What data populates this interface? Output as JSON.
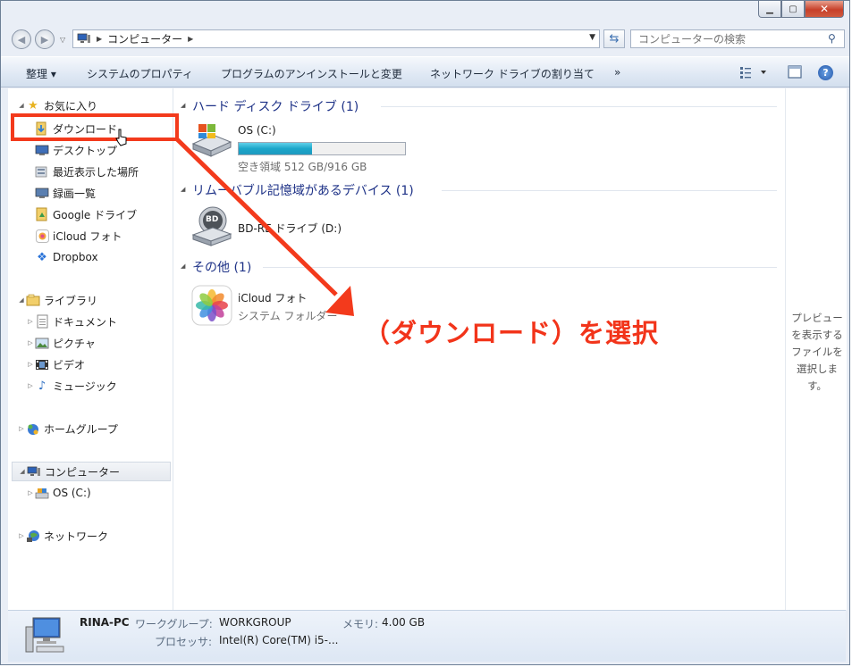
{
  "window": {
    "caption": {
      "minimize": "▁",
      "maximize": "▢",
      "close": "✕"
    }
  },
  "address": {
    "crumb": "コンピューター",
    "search_placeholder": "コンピューターの検索"
  },
  "toolbar": {
    "organize": "整理 ▾",
    "system_properties": "システムのプロパティ",
    "uninstall": "プログラムのアンインストールと変更",
    "map_drive": "ネットワーク ドライブの割り当て",
    "more": "»",
    "help": "?"
  },
  "nav": {
    "favorites": "お気に入り",
    "downloads": "ダウンロード",
    "desktop": "デスクトップ",
    "recent": "最近表示した場所",
    "recordings": "録画一覧",
    "google_drive": "Google ドライブ",
    "icloud_photos": "iCloud フォト",
    "dropbox": "Dropbox",
    "libraries": "ライブラリ",
    "documents": "ドキュメント",
    "pictures": "ピクチャ",
    "videos": "ビデオ",
    "music": "ミュージック",
    "homegroup": "ホームグループ",
    "computer": "コンピューター",
    "os_c": "OS (C:)",
    "network": "ネットワーク"
  },
  "content": {
    "group_hdd": "ハード ディスク ドライブ (1)",
    "os_drive_name": "OS (C:)",
    "os_drive_free": "空き領域 512 GB/916 GB",
    "os_drive_used_fraction": 0.44,
    "group_removable": "リムーバブル記憶域があるデバイス (1)",
    "bd_drive_name": "BD-RE ドライブ (D:)",
    "bd_label": "BD",
    "group_other": "その他 (1)",
    "icloud_name": "iCloud フォト",
    "icloud_sub": "システム フォルダー"
  },
  "preview": {
    "line1": "プレビュー",
    "line2": "を表示する",
    "line3": "ファイルを",
    "line4": "選択しま",
    "line5": "す。"
  },
  "details": {
    "pc_name": "RINA-PC",
    "workgroup_label": "ワークグループ:",
    "workgroup_value": "WORKGROUP",
    "memory_label": "メモリ:",
    "memory_value": "4.00 GB",
    "processor_label": "プロセッサ:",
    "processor_value": "Intel(R) Core(TM) i5-..."
  },
  "annotation": {
    "text": "（ダウンロード）を選択",
    "color": "#f2341a"
  }
}
